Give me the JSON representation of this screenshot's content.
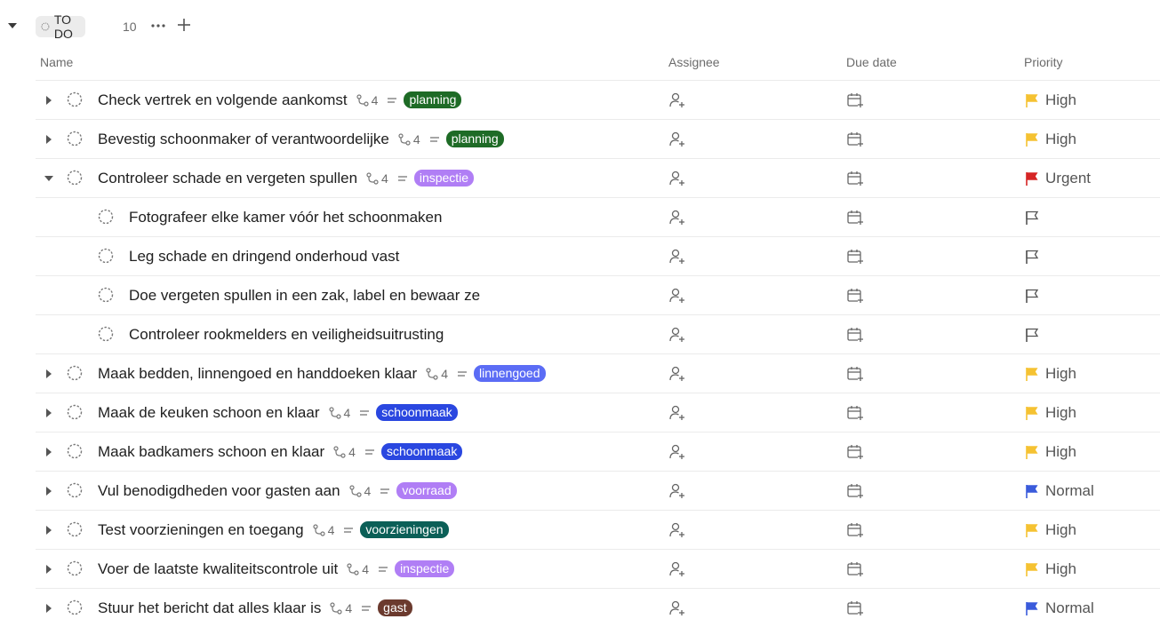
{
  "group": {
    "status_label": "TO DO",
    "count": "10"
  },
  "columns": {
    "name": "Name",
    "assignee": "Assignee",
    "due_date": "Due date",
    "priority": "Priority"
  },
  "colors": {
    "urgent": "#d62525",
    "high": "#f5c232",
    "normal": "#3a5bdb",
    "none": "#555555"
  },
  "tasks": [
    {
      "title": "Check vertrek en volgende aankomst",
      "subtasks": "4",
      "tag": "planning",
      "tag_color": "#1e6b26",
      "priority": "High",
      "expanded": false,
      "level": 0
    },
    {
      "title": "Bevestig schoonmaker of verantwoordelijke",
      "subtasks": "4",
      "tag": "planning",
      "tag_color": "#1e6b26",
      "priority": "High",
      "expanded": false,
      "level": 0
    },
    {
      "title": "Controleer schade en vergeten spullen",
      "subtasks": "4",
      "tag": "inspectie",
      "tag_color": "#b07ef5",
      "priority": "Urgent",
      "expanded": true,
      "level": 0
    },
    {
      "title": "Fotografeer elke kamer vóór het schoonmaken",
      "subtasks": "",
      "tag": "",
      "tag_color": "",
      "priority": "",
      "expanded": false,
      "level": 1
    },
    {
      "title": "Leg schade en dringend onderhoud vast",
      "subtasks": "",
      "tag": "",
      "tag_color": "",
      "priority": "",
      "expanded": false,
      "level": 1
    },
    {
      "title": "Doe vergeten spullen in een zak, label en bewaar ze",
      "subtasks": "",
      "tag": "",
      "tag_color": "",
      "priority": "",
      "expanded": false,
      "level": 1
    },
    {
      "title": "Controleer rookmelders en veiligheidsuitrusting",
      "subtasks": "",
      "tag": "",
      "tag_color": "",
      "priority": "",
      "expanded": false,
      "level": 1
    },
    {
      "title": "Maak bedden, linnengoed en handdoeken klaar",
      "subtasks": "4",
      "tag": "linnengoed",
      "tag_color": "#5b6cf5",
      "priority": "High",
      "expanded": false,
      "level": 0
    },
    {
      "title": "Maak de keuken schoon en klaar",
      "subtasks": "4",
      "tag": "schoonmaak",
      "tag_color": "#2a47e0",
      "priority": "High",
      "expanded": false,
      "level": 0
    },
    {
      "title": "Maak badkamers schoon en klaar",
      "subtasks": "4",
      "tag": "schoonmaak",
      "tag_color": "#2a47e0",
      "priority": "High",
      "expanded": false,
      "level": 0
    },
    {
      "title": "Vul benodigdheden voor gasten aan",
      "subtasks": "4",
      "tag": "voorraad",
      "tag_color": "#b07ef5",
      "priority": "Normal",
      "expanded": false,
      "level": 0
    },
    {
      "title": "Test voorzieningen en toegang",
      "subtasks": "4",
      "tag": "voorzieningen",
      "tag_color": "#0b5f57",
      "priority": "High",
      "expanded": false,
      "level": 0
    },
    {
      "title": "Voer de laatste kwaliteitscontrole uit",
      "subtasks": "4",
      "tag": "inspectie",
      "tag_color": "#b07ef5",
      "priority": "High",
      "expanded": false,
      "level": 0
    },
    {
      "title": "Stuur het bericht dat alles klaar is",
      "subtasks": "4",
      "tag": "gast",
      "tag_color": "#6b3a2e",
      "priority": "Normal",
      "expanded": false,
      "level": 0
    }
  ]
}
